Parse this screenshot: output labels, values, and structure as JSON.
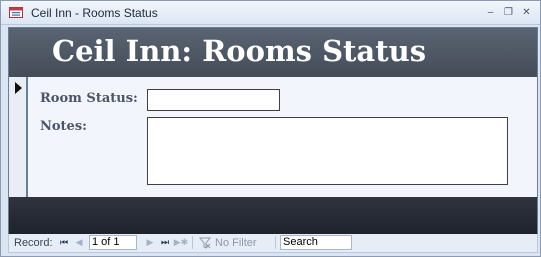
{
  "window": {
    "title": "Ceil Inn - Rooms Status",
    "minimize_glyph": "‒",
    "restore_glyph": "❐",
    "close_glyph": "✕"
  },
  "form": {
    "header_title": "Ceil Inn: Rooms Status",
    "fields": {
      "room_status_label": "Room Status:",
      "room_status_value": "",
      "notes_label": "Notes:",
      "notes_value": ""
    }
  },
  "record_nav": {
    "label": "Record:",
    "first_glyph": "⏮",
    "prev_glyph": "◀",
    "position": "1 of 1",
    "next_glyph": "▶",
    "last_glyph": "⏭",
    "new_glyph": "▶✱",
    "filter_icon": "funnel-x-icon",
    "filter_label": "No Filter",
    "search_placeholder": "Search"
  },
  "colors": {
    "header_bg": "#4d5561",
    "footer_bg": "#252a34",
    "detail_bg": "#f2f6fc"
  }
}
